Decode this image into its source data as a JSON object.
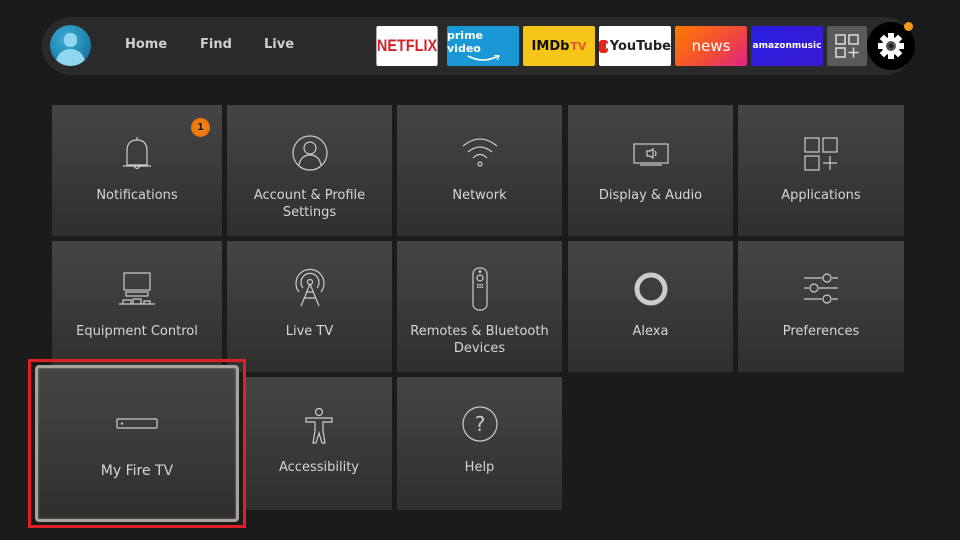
{
  "topbar": {
    "nav": [
      "Home",
      "Find",
      "Live"
    ],
    "apps": [
      {
        "name": "Netflix",
        "label": "NETFLIX",
        "bg": "#ffffff"
      },
      {
        "name": "Prime Video",
        "label": "prime video",
        "bg": "#1a98d5"
      },
      {
        "name": "IMDb TV",
        "label": "IMDb",
        "suffix": "TV",
        "bg": "#f5c518"
      },
      {
        "name": "YouTube",
        "label": "YouTube",
        "bg": "#ffffff"
      },
      {
        "name": "News",
        "label": "news",
        "bg": "#ff7a00"
      },
      {
        "name": "Amazon Music",
        "label_a": "amazon",
        "label_b": " music",
        "bg": "#2a1ee0"
      }
    ],
    "settings_notification_color": "#f59b1c"
  },
  "settings": {
    "tiles": [
      {
        "label": "Notifications",
        "icon": "bell-icon",
        "badge": "1"
      },
      {
        "label": "Account & Profile Settings",
        "icon": "profile-icon"
      },
      {
        "label": "Network",
        "icon": "wifi-icon"
      },
      {
        "label": "Display & Audio",
        "icon": "display-audio-icon"
      },
      {
        "label": "Applications",
        "icon": "applications-icon"
      },
      {
        "label": "Equipment Control",
        "icon": "equipment-icon"
      },
      {
        "label": "Live TV",
        "icon": "antenna-icon"
      },
      {
        "label": "Remotes & Bluetooth Devices",
        "icon": "remote-icon"
      },
      {
        "label": "Alexa",
        "icon": "alexa-icon"
      },
      {
        "label": "Preferences",
        "icon": "sliders-icon"
      },
      {
        "label": "My Fire TV",
        "icon": "fire-tv-device-icon",
        "focused": true
      },
      {
        "label": "Accessibility",
        "icon": "accessibility-icon"
      },
      {
        "label": "Help",
        "icon": "help-icon"
      }
    ],
    "highlight_color": "#e01e26"
  }
}
